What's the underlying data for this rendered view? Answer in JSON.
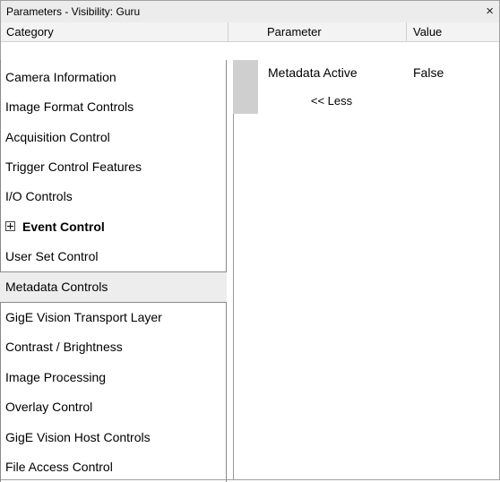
{
  "window": {
    "title": "Parameters - Visibility: Guru",
    "close_glyph": "×"
  },
  "headers": {
    "category": "Category",
    "parameter": "Parameter",
    "value": "Value"
  },
  "categories": [
    {
      "label": "Camera Information"
    },
    {
      "label": "Image Format Controls"
    },
    {
      "label": "Acquisition Control"
    },
    {
      "label": "Trigger Control Features"
    },
    {
      "label": "I/O Controls"
    },
    {
      "label": "Event Control",
      "expandable": true
    },
    {
      "label": "User Set Control"
    },
    {
      "label": "Metadata Controls",
      "selected": true
    },
    {
      "label": "GigE Vision Transport Layer"
    },
    {
      "label": "Contrast / Brightness"
    },
    {
      "label": "Image Processing"
    },
    {
      "label": "Overlay Control"
    },
    {
      "label": "GigE Vision Host Controls"
    },
    {
      "label": "File Access Control"
    }
  ],
  "parameters": [
    {
      "name": "Metadata Active",
      "value": "False"
    }
  ],
  "less_button": "<< Less",
  "colors": {
    "selected_bg": "#ededed",
    "header_bg": "#f3f3f3",
    "border": "#8a8a8a"
  },
  "icons": {
    "close": "close-icon",
    "expander": "plus-box-icon"
  }
}
